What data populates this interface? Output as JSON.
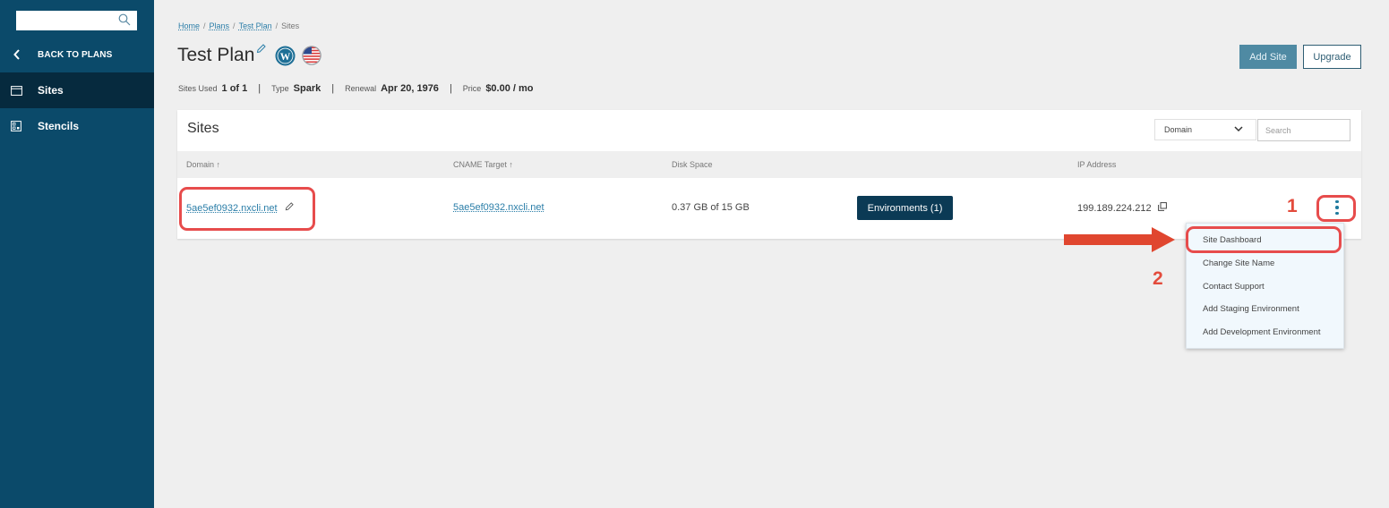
{
  "sidebar": {
    "search_placeholder": "",
    "back_label": "BACK TO PLANS",
    "items": [
      {
        "label": "Sites",
        "icon": "browser-window-icon",
        "active": true
      },
      {
        "label": "Stencils",
        "icon": "stencil-icon",
        "active": false
      }
    ]
  },
  "breadcrumb": {
    "items": [
      "Home",
      "Plans",
      "Test Plan",
      "Sites"
    ]
  },
  "header": {
    "title": "Test Plan",
    "meta": {
      "sites_used_label": "Sites Used",
      "sites_used_value": "1 of 1",
      "type_label": "Type",
      "type_value": "Spark",
      "renewal_label": "Renewal",
      "renewal_value": "Apr 20, 1976",
      "price_label": "Price",
      "price_value": "$0.00 / mo",
      "separator": "|"
    },
    "add_site_label": "Add Site",
    "upgrade_label": "Upgrade"
  },
  "sites_card": {
    "title": "Sites",
    "filter_selected": "Domain",
    "search_placeholder": "Search",
    "columns": [
      "Domain ↑",
      "CNAME Target ↑",
      "Disk Space",
      "IP Address"
    ],
    "rows": [
      {
        "domain": "5ae5ef0932.nxcli.net",
        "cname": "5ae5ef0932.nxcli.net",
        "disk_space": "0.37 GB of 15 GB",
        "environments_label": "Environments (1)",
        "ip_address": "199.189.224.212"
      }
    ]
  },
  "row_menu": {
    "items": [
      "Site Dashboard",
      "Change Site Name",
      "Contact Support",
      "Add Staging Environment",
      "Add Development Environment"
    ]
  },
  "annotations": {
    "step1": "1",
    "step2": "2",
    "color": "#e34b3c"
  },
  "colors": {
    "sidebar_bg": "#0b4a6a",
    "sidebar_active": "#062a3e",
    "primary_button": "#4f8aa3",
    "env_button": "#0b3a55",
    "link": "#2b7ea8"
  }
}
